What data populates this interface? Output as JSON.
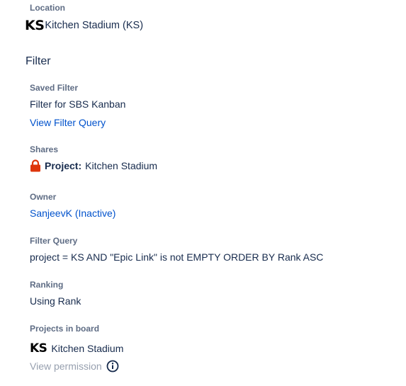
{
  "location": {
    "label": "Location",
    "logo_text": "KS",
    "value": "Kitchen Stadium (KS)"
  },
  "filter_section": {
    "heading": "Filter"
  },
  "saved_filter": {
    "label": "Saved Filter",
    "value": "Filter for SBS Kanban",
    "link": "View Filter Query"
  },
  "shares": {
    "label": "Shares",
    "icon": "lock-icon",
    "type_label": "Project:",
    "value": "Kitchen Stadium"
  },
  "owner": {
    "label": "Owner",
    "value": "SanjeevK (Inactive)"
  },
  "filter_query": {
    "label": "Filter Query",
    "value": "project = KS AND \"Epic Link\" is not EMPTY ORDER BY Rank ASC"
  },
  "ranking": {
    "label": "Ranking",
    "value": "Using Rank"
  },
  "projects_in_board": {
    "label": "Projects in board",
    "logo_text": "KS",
    "project_name": "Kitchen Stadium",
    "permission_link": "View permission",
    "info_icon": "info-icon"
  },
  "colors": {
    "link": "#0052cc",
    "label": "#5e6c84",
    "text": "#172b4d",
    "lock": "#de350b",
    "muted": "#97a0af"
  }
}
